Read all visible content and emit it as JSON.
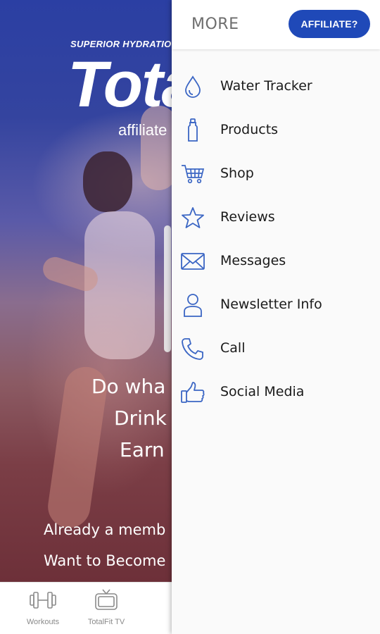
{
  "background": {
    "brand_tagline": "SUPERIOR HYDRATIO",
    "brand_logo": "Tota",
    "brand_sub": "affiliate",
    "hero_lines": [
      "Do wha",
      "Drink",
      "Earn",
      "Already a memb",
      "Want to Become"
    ],
    "tabs": [
      {
        "label": "Workouts",
        "icon": "dumbbell-icon"
      },
      {
        "label": "TotalFit TV",
        "icon": "tv-icon"
      }
    ]
  },
  "drawer": {
    "title": "MORE",
    "affiliate_button": "AFFILIATE?",
    "accent_color": "#1f49b8",
    "icon_color": "#3b66c4",
    "items": [
      {
        "label": "Water Tracker",
        "icon": "water-drop-icon"
      },
      {
        "label": "Products",
        "icon": "bottle-icon"
      },
      {
        "label": "Shop",
        "icon": "shopping-cart-icon"
      },
      {
        "label": "Reviews",
        "icon": "star-icon"
      },
      {
        "label": "Messages",
        "icon": "envelope-icon"
      },
      {
        "label": "Newsletter Info",
        "icon": "person-icon"
      },
      {
        "label": "Call",
        "icon": "phone-icon"
      },
      {
        "label": "Social Media",
        "icon": "thumbs-up-icon"
      }
    ]
  }
}
